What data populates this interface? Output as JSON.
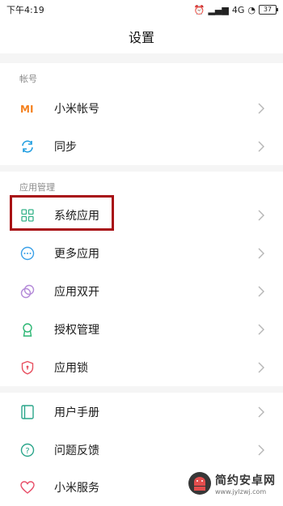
{
  "status_bar": {
    "time": "下午4:19",
    "network": "4G",
    "battery": "37"
  },
  "title": "设置",
  "sections": {
    "account": {
      "header": "帐号"
    },
    "apps": {
      "header": "应用管理"
    }
  },
  "items": {
    "mi_account": "小米帐号",
    "sync": "同步",
    "system_apps": "系统应用",
    "more_apps": "更多应用",
    "dual_apps": "应用双开",
    "permissions": "授权管理",
    "app_lock": "应用锁",
    "user_manual": "用户手册",
    "feedback": "问题反馈",
    "mi_services": "小米服务"
  },
  "watermark": {
    "name": "简约安卓网",
    "url": "www.jylzwj.com"
  },
  "colors": {
    "mi_orange": "#f58220",
    "sync_blue": "#1f9de0",
    "system_green": "#35b38a",
    "more_blue": "#3aa0e8",
    "dual_purple": "#b48ad8",
    "perm_green": "#2bb673",
    "lock_red": "#e85060",
    "manual_teal": "#2aa58a",
    "feedback_teal": "#2aa58a",
    "services_red": "#e8506a",
    "highlight": "#a80f14"
  }
}
